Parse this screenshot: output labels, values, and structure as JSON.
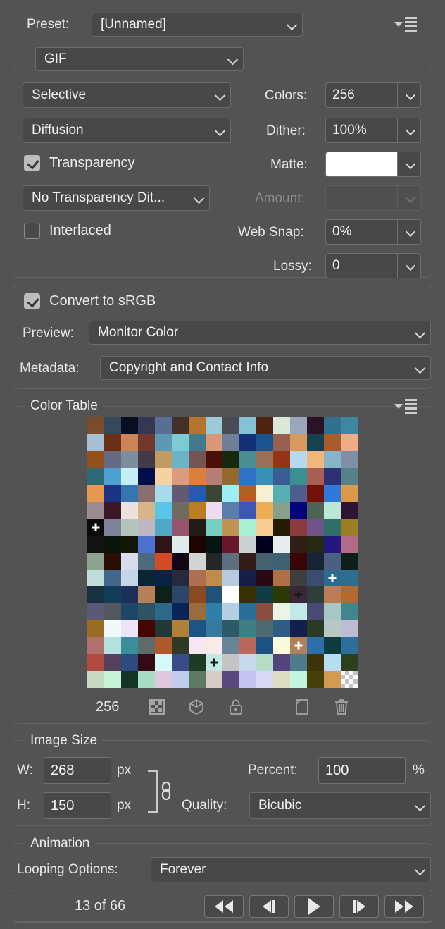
{
  "panel": {
    "preset_label": "Preset:",
    "preset_value": "[Unnamed]",
    "format_value": "GIF",
    "menu_icon": "panel-menu-icon"
  },
  "optimize": {
    "reduction_algorithm": "Selective",
    "dither_algorithm": "Diffusion",
    "colors_label": "Colors:",
    "colors_value": "256",
    "dither_label": "Dither:",
    "dither_value": "100%",
    "transparency_label": "Transparency",
    "transparency_checked": true,
    "matte_label": "Matte:",
    "matte_color": "#ffffff",
    "transparency_dither": "No Transparency Dit...",
    "amount_label": "Amount:",
    "amount_value": "",
    "amount_disabled": true,
    "interlaced_label": "Interlaced",
    "interlaced_checked": false,
    "websnap_label": "Web Snap:",
    "websnap_value": "0%",
    "lossy_label": "Lossy:",
    "lossy_value": "0"
  },
  "color_management": {
    "convert_srgb_label": "Convert to sRGB",
    "convert_srgb_checked": true,
    "preview_label": "Preview:",
    "preview_value": "Monitor Color",
    "metadata_label": "Metadata:",
    "metadata_value": "Copyright and Contact Info"
  },
  "color_table": {
    "title": "Color Table",
    "menu_icon": "panel-menu-icon",
    "count": "256",
    "icons": [
      "transparency-checker-icon",
      "web-safe-cube-icon",
      "lock-icon",
      "new-color-page-icon",
      "delete-trash-icon"
    ],
    "swatches": [
      "#7a4c2b",
      "#35495a",
      "#090f22",
      "#343853",
      "#5a6e95",
      "#44302a",
      "#b4762f",
      "#9ccbd8",
      "#4a4a52",
      "#85c2d6",
      "#4e2410",
      "#dbe8d8",
      "#9aa7ba",
      "#2a1326",
      "#31718e",
      "#3d87a0",
      "#a5c0d2",
      "#6b3017",
      "#cd8558",
      "#73382b",
      "#5d9ab1",
      "#7ccbd4",
      "#43788d",
      "#da9976",
      "#6f7f98",
      "#143077",
      "#1c5490",
      "#98604f",
      "#d79a5c",
      "#17414f",
      "#ab5a2c",
      "#f0ac87",
      "#92501d",
      "#666a82",
      "#7c8d9b",
      "#423a44",
      "#c29b64",
      "#6bb3c6",
      "#75554f",
      "#4b1006",
      "#16290f",
      "#4a8e94",
      "#9b7057",
      "#953316",
      "#b7d8ee",
      "#f0b77a",
      "#86b4c9",
      "#7f8fa6",
      "#2e6a76",
      "#4fa0d3",
      "#c4eef6",
      "#020e4b",
      "#f5d2a0",
      "#dc9b7f",
      "#da803c",
      "#b67e76",
      "#94692d",
      "#2f72c5",
      "#3a90b4",
      "#3a5d96",
      "#3a8f91",
      "#a85e53",
      "#2b3173",
      "#58808a",
      "#e7974f",
      "#1c3384",
      "#3775b2",
      "#8a6e6b",
      "#a7dbec",
      "#615a70",
      "#2759ae",
      "#3b4632",
      "#9deef5",
      "#b0601f",
      "#f5efd4",
      "#55b0b4",
      "#4f5c8e",
      "#711207",
      "#3179d8",
      "#db9a4b",
      "#9b8c94",
      "#3d1725",
      "#ebe1dd",
      "#d8b588",
      "#59c5ea",
      "#716a5f",
      "#ba7d22",
      "#f0dcf0",
      "#5b7da9",
      "#4056b6",
      "#edae55",
      "#87a08d",
      "#000578",
      "#4f6355",
      "#bde8d5",
      "#2a1535",
      "#0d0a0b",
      "#808299",
      "#b3c4bb",
      "#bfb8c4",
      "#4fa8c5",
      "#96546f",
      "#231a16",
      "#76cfc1",
      "#c19352",
      "#a9f0d5",
      "#f5cd93",
      "#251b02",
      "#8c3a3f",
      "#6e5487",
      "#2e6f68",
      "#9b7e25",
      "#141414",
      "#081507",
      "#121605",
      "#4b72cf",
      "#2e1416",
      "#dfeaea",
      "#1c0400",
      "#051413",
      "#68182b",
      "#c9d2d1",
      "#02021d",
      "#e9ecec",
      "#311f17",
      "#242a13",
      "#22177e",
      "#b26b87",
      "#8fa391",
      "#291002",
      "#d8dbeb",
      "#4d6a7c",
      "#d04b26",
      "#130513",
      "#d2d4d2",
      "#262629",
      "#5e6f80",
      "#321d1b",
      "#45606e",
      "#3f5f72",
      "#3a0604",
      "#152535",
      "#4b5f82",
      "#0d1f18",
      "#c0ddd9",
      "#46678c",
      "#c5d6e8",
      "#0a2533",
      "#0a2345",
      "#252a3f",
      "#ae7050",
      "#c08b4b",
      "#b8cade",
      "#151f48",
      "#2a0915",
      "#ae7044",
      "#3e3e3e",
      "#3a4c70",
      "#2b6b8f",
      "#2e6f90",
      "#17323f",
      "#113d56",
      "#1c2e5a",
      "#b5815b",
      "#0d2019",
      "#2c4667",
      "#8a4a21",
      "#1f5179",
      "#ffffff",
      "#392f05",
      "#0f3c45",
      "#2c3a05",
      "#3c2639",
      "#2e3f39",
      "#bc7c55",
      "#b46a2c",
      "#5a5a78",
      "#54565e",
      "#1d4669",
      "#2e5463",
      "#2c6889",
      "#082559",
      "#9a6b3d",
      "#2f7fa8",
      "#b5cfe2",
      "#2c6e9a",
      "#8a4d3f",
      "#e9f5e5",
      "#c2e8e8",
      "#4b4a72",
      "#a7c7c4",
      "#41868d",
      "#9a6b22",
      "#eefbfa",
      "#ece5f8",
      "#470502",
      "#1f3838",
      "#b08037",
      "#1d5488",
      "#337a9e",
      "#2d5a66",
      "#3e7e84",
      "#4e6a6e",
      "#2d5d84",
      "#141f4e",
      "#2a3a26",
      "#b5c8c6",
      "#bcbcd2",
      "#b0706b",
      "#b5e2de",
      "#3a8e9b",
      "#5d6b6a",
      "#b05a2c",
      "#2e3a26",
      "#f8e6f5",
      "#fbeae5",
      "#6a8497",
      "#b8695c",
      "#1d5285",
      "#fbfadb",
      "#b0805a",
      "#2d6fa8",
      "#0f3a3f",
      "#2c6f9b",
      "#b0493f",
      "#554159",
      "#2d4b7c",
      "#350a15",
      "#d5f8f8",
      "#3a4b87",
      "#1e3c22",
      "#c2e8e8",
      "#c4c4c4",
      "#c8d8ee",
      "#b5ddc5",
      "#55437e",
      "#4d7c88",
      "#3d3306",
      "#b5ddf5",
      "#2e3f1f",
      "#c8d8c2",
      "#c8f5d8",
      "#123526",
      "#a8ddc4",
      "#dfc8dd",
      "#c2cdee",
      "#5d7a62",
      "#d8cac4",
      "#5b4780",
      "#c4c4ee",
      "#d8d8f5",
      "#dedcc2",
      "#c2f5dd",
      "#453f08",
      "#d59a4f",
      "CHECKER"
    ],
    "markers": {
      "96": "plus",
      "172": "diamond",
      "220": "plus",
      "231": "diamond",
      "158": "plus"
    }
  },
  "image_size": {
    "title": "Image Size",
    "w_label": "W:",
    "w_value": "268",
    "w_unit": "px",
    "h_label": "H:",
    "h_value": "150",
    "h_unit": "px",
    "chain_icon": "chain-link-icon",
    "percent_label": "Percent:",
    "percent_value": "100",
    "percent_unit": "%",
    "quality_label": "Quality:",
    "quality_value": "Bicubic"
  },
  "animation": {
    "title": "Animation",
    "looping_label": "Looping Options:",
    "looping_value": "Forever",
    "frame_counter": "13 of 66",
    "buttons": [
      "first-frame-button",
      "previous-frame-button",
      "play-button",
      "next-frame-button",
      "last-frame-button"
    ]
  }
}
